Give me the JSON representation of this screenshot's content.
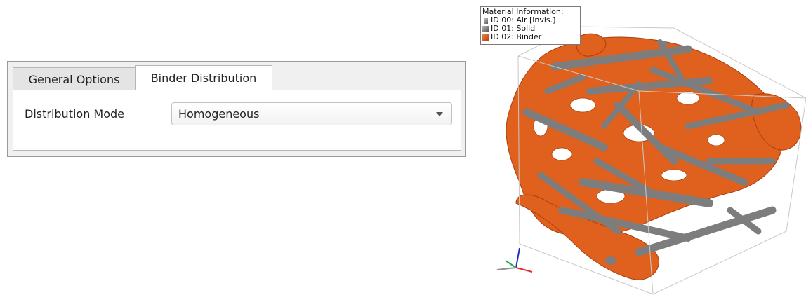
{
  "tabs": [
    {
      "label": "General Options"
    },
    {
      "label": "Binder Distribution"
    }
  ],
  "binder_tab": {
    "distribution_mode_label": "Distribution Mode",
    "distribution_mode_value": "Homogeneous"
  },
  "viewer": {
    "legend": {
      "title": "Material Information:",
      "items": [
        {
          "label": "ID 00: Air [invis.]",
          "color": "#8a8a8a"
        },
        {
          "label": "ID 01: Solid",
          "color": "#808080"
        },
        {
          "label": "ID 02: Binder",
          "color": "#e0601e"
        }
      ]
    },
    "colors": {
      "binder": "#e0601e",
      "solid": "#7d7d7d",
      "bounding_box": "#c8c8c8"
    },
    "axes": {
      "x_color": "#e03030",
      "y_color": "#20b040",
      "z_color": "#2030c0"
    }
  }
}
